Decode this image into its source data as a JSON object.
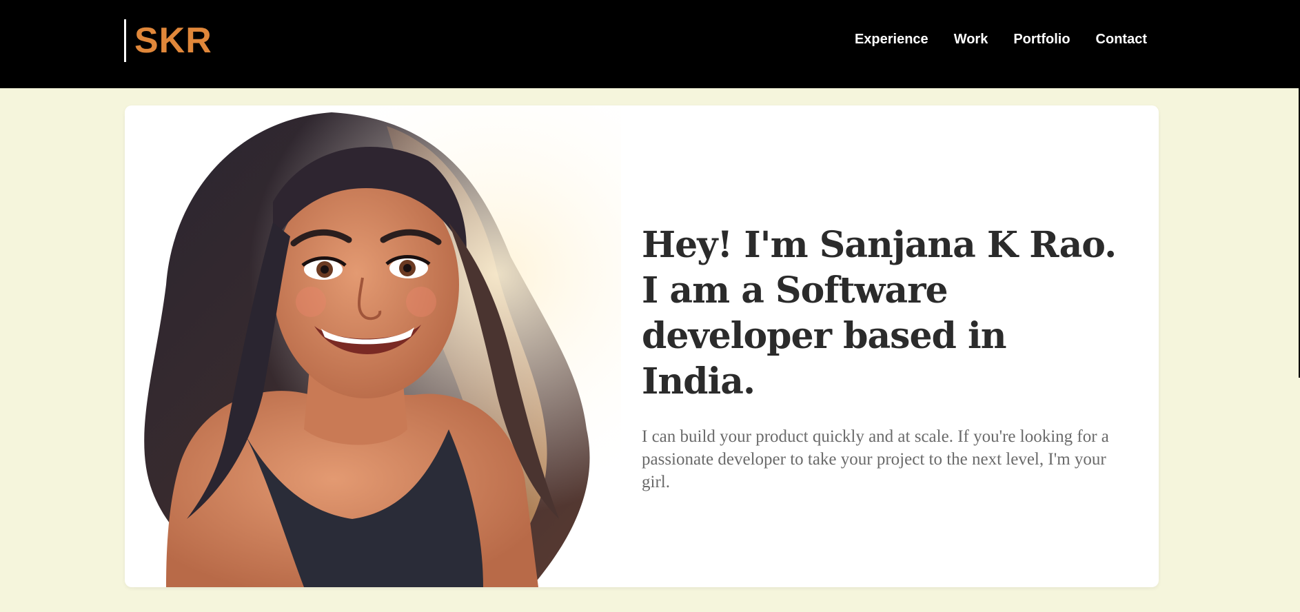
{
  "header": {
    "logo": "SKR",
    "nav": [
      {
        "label": "Experience"
      },
      {
        "label": "Work"
      },
      {
        "label": "Portfolio"
      },
      {
        "label": "Contact"
      }
    ]
  },
  "hero": {
    "headline": "Hey! I'm Sanjana K Rao. I am a Software developer based in India.",
    "description": "I can build your product quickly and at scale. If you're looking for a passionate developer to take your project to the next level, I'm your girl.",
    "portrait_icon": "smiling-woman-illustration"
  },
  "colors": {
    "page_bg": "#f5f5dc",
    "header_bg": "#000000",
    "logo": "#e0873a",
    "nav_text": "#ffffff",
    "headline": "#2b2b2b",
    "description": "#6a6a6a",
    "card_bg": "#ffffff"
  }
}
